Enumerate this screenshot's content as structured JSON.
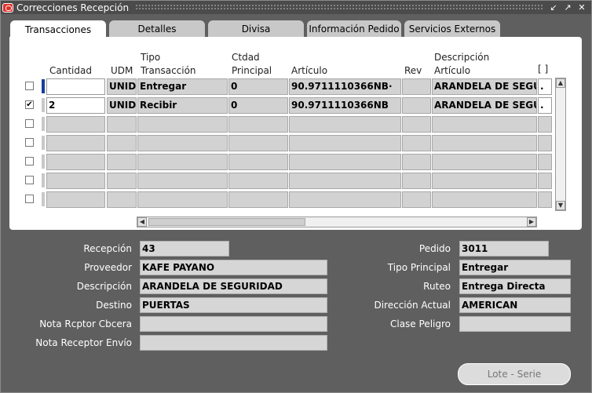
{
  "window": {
    "title": "Correcciones Recepción",
    "buttons": [
      "↙",
      "↗",
      "✕"
    ]
  },
  "tabs": [
    {
      "label": "Transacciones",
      "active": true
    },
    {
      "label": "Detalles",
      "active": false
    },
    {
      "label": "Divisa",
      "active": false
    },
    {
      "label": "Información Pedido",
      "active": false
    },
    {
      "label": "Servicios Externos",
      "active": false
    }
  ],
  "table": {
    "headers": {
      "cantidad": "Cantidad",
      "udm": "UDM",
      "tipo_1": "Tipo",
      "tipo_2": "Transacción",
      "ctdad_1": "Ctdad",
      "ctdad_2": "Principal",
      "articulo": "Artículo",
      "rev": "Rev",
      "desc_1": "Descripción",
      "desc_2": "Artículo",
      "extra": "[ ]"
    },
    "rows": [
      {
        "checked": false,
        "cantidad": "",
        "udm": "UNID.",
        "tipo": "Entregar",
        "ctdad": "0",
        "articulo": "90.9711110366NB·",
        "rev": "",
        "descripcion": "ARANDELA DE SEGU",
        "extra": "."
      },
      {
        "checked": true,
        "cantidad": "2",
        "udm": "UNID.",
        "tipo": "Recibir",
        "ctdad": "0",
        "articulo": "90.9711110366NB",
        "rev": "",
        "descripcion": "ARANDELA DE SEGU",
        "extra": "."
      }
    ],
    "checkmark": "✔"
  },
  "form": {
    "recepcion_label": "Recepción",
    "recepcion_value": "43",
    "proveedor_label": "Proveedor",
    "proveedor_value": "KAFE PAYANO",
    "descripcion_label": "Descripción",
    "descripcion_value": "ARANDELA DE SEGURIDAD",
    "destino_label": "Destino",
    "destino_value": "PUERTAS",
    "nota_cabecera_label": "Nota Rcptor Cbcera",
    "nota_cabecera_value": "",
    "nota_envio_label": "Nota Receptor Envío",
    "nota_envio_value": "",
    "pedido_label": "Pedido",
    "pedido_value": "3011",
    "tipo_principal_label": "Tipo Principal",
    "tipo_principal_value": "Entregar",
    "ruteo_label": "Ruteo",
    "ruteo_value": "Entrega Directa",
    "direccion_label": "Dirección Actual",
    "direccion_value": "AMERICAN",
    "clase_peligro_label": "Clase Peligro",
    "clase_peligro_value": ""
  },
  "lote_button": "Lote - Serie",
  "colors": {
    "background": "#5f5f5f",
    "field": "#d6d6d6",
    "active_row_marker": "#1a3c9c"
  }
}
